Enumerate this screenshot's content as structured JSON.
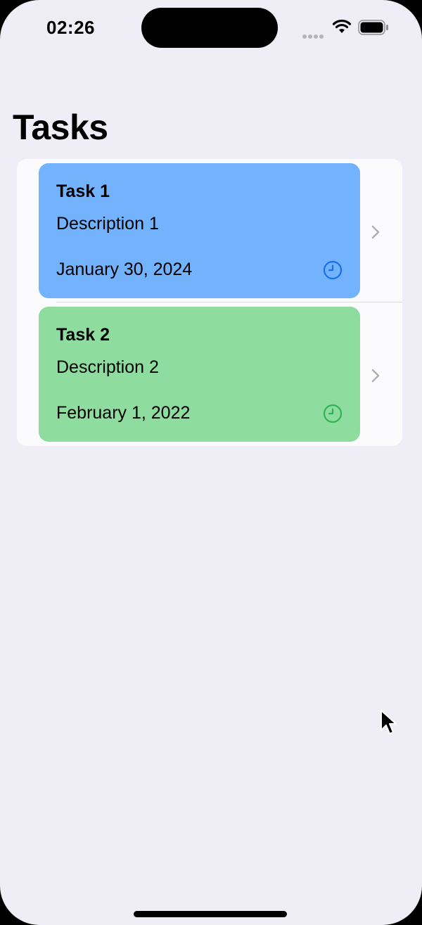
{
  "status_bar": {
    "time": "02:26",
    "icons": [
      "cellular-signal-icon",
      "wifi-icon",
      "battery-icon"
    ]
  },
  "page": {
    "title": "Tasks"
  },
  "tasks": [
    {
      "title": "Task 1",
      "description": "Description 1",
      "date": "January 30, 2024",
      "card_color": "#73b2fd",
      "icon_color": "#1a6fe8",
      "icon": "clock-icon"
    },
    {
      "title": "Task 2",
      "description": "Description 2",
      "date": "February 1, 2022",
      "card_color": "#8fdd9e",
      "icon_color": "#2fb255",
      "icon": "clock-icon"
    }
  ],
  "colors": {
    "background": "#efeef6",
    "list_background": "#fbfbfd",
    "chevron": "#b0b0b5"
  }
}
